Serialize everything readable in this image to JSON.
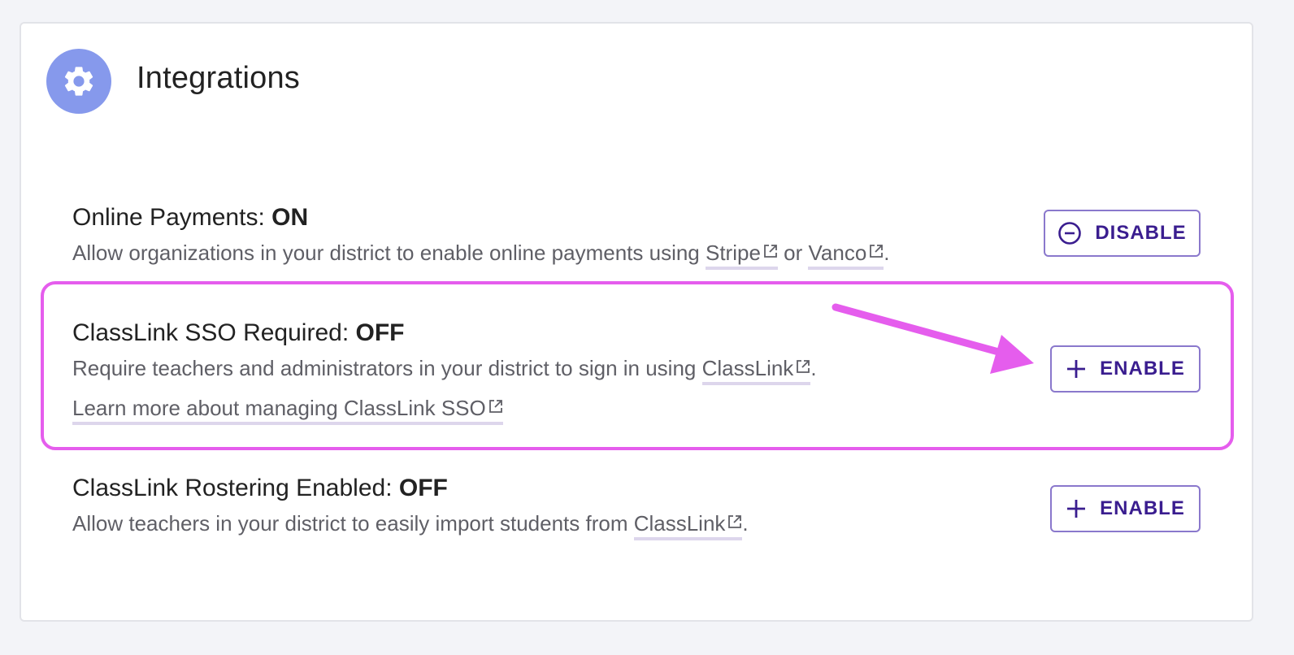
{
  "header": {
    "title": "Integrations",
    "icon": "gear-icon",
    "icon_color": "#8699ec"
  },
  "integrations": [
    {
      "title_prefix": "Online Payments: ",
      "status": "ON",
      "desc_prefix": "Allow organizations in your district to enable online payments using ",
      "link1": "Stripe",
      "desc_middle": " or ",
      "link2": "Vanco",
      "desc_suffix": ".",
      "button_label": "DISABLE",
      "button_icon": "minus-circle-icon"
    },
    {
      "title_prefix": "ClassLink SSO Required: ",
      "status": "OFF",
      "desc_prefix": "Require teachers and administrators in your district to sign in using ",
      "link1": "ClassLink",
      "desc_suffix": ".",
      "learn_more": "Learn more about managing ClassLink SSO",
      "button_label": "ENABLE",
      "button_icon": "plus-icon",
      "highlighted": true
    },
    {
      "title_prefix": "ClassLink Rostering Enabled: ",
      "status": "OFF",
      "desc_prefix": "Allow teachers in your district to easily import students from ",
      "link1": "ClassLink",
      "desc_suffix": ".",
      "button_label": "ENABLE",
      "button_icon": "plus-icon"
    }
  ],
  "colors": {
    "accent": "#3a1d8f",
    "button_border": "#8a78cc",
    "highlight": "#e55ded",
    "link_underline": "#ddd6ec"
  }
}
